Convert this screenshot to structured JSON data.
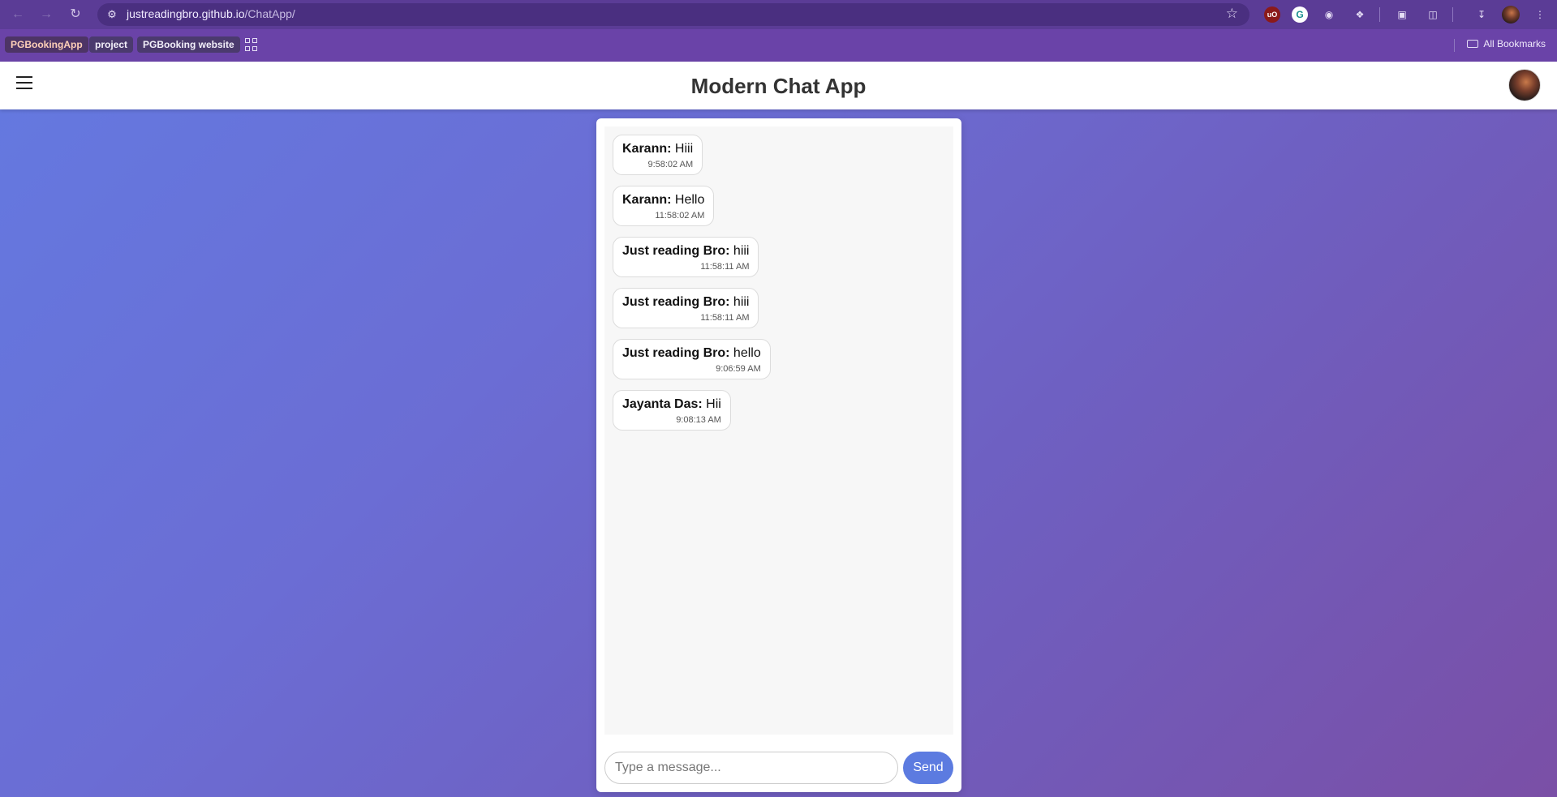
{
  "browser": {
    "url_host": "justreadingbro.github.io",
    "url_path": "/ChatApp/",
    "bookmarks": [
      "PGBookingApp",
      "project",
      "PGBooking website"
    ],
    "all_bookmarks_label": "All Bookmarks",
    "icons": [
      "back-arrow-icon",
      "forward-arrow-icon",
      "reload-icon",
      "site-info-icon",
      "star-icon",
      "ublock-icon",
      "extension-icon",
      "camera-icon",
      "puzzle-icon",
      "lens-icon",
      "tab-search-icon",
      "download-icon",
      "menu-dots-icon"
    ]
  },
  "app": {
    "title": "Modern Chat App"
  },
  "messages": [
    {
      "sender": "Karann:",
      "text": "Hiii",
      "time": "9:58:02 AM"
    },
    {
      "sender": "Karann:",
      "text": "Hello",
      "time": "11:58:02 AM"
    },
    {
      "sender": "Just reading Bro:",
      "text": "hiii",
      "time": "11:58:11 AM"
    },
    {
      "sender": "Just reading Bro:",
      "text": "hiii",
      "time": "11:58:11 AM"
    },
    {
      "sender": "Just reading Bro:",
      "text": "hello",
      "time": "9:06:59 AM"
    },
    {
      "sender": "Jayanta Das:",
      "text": "Hii",
      "time": "9:08:13 AM"
    }
  ],
  "composer": {
    "placeholder": "Type a message...",
    "send_label": "Send"
  },
  "colors": {
    "accent": "#5c7be0",
    "browser_frame": "#5b3c96",
    "gradient_start": "#6479e0",
    "gradient_end": "#7a4fa6"
  }
}
